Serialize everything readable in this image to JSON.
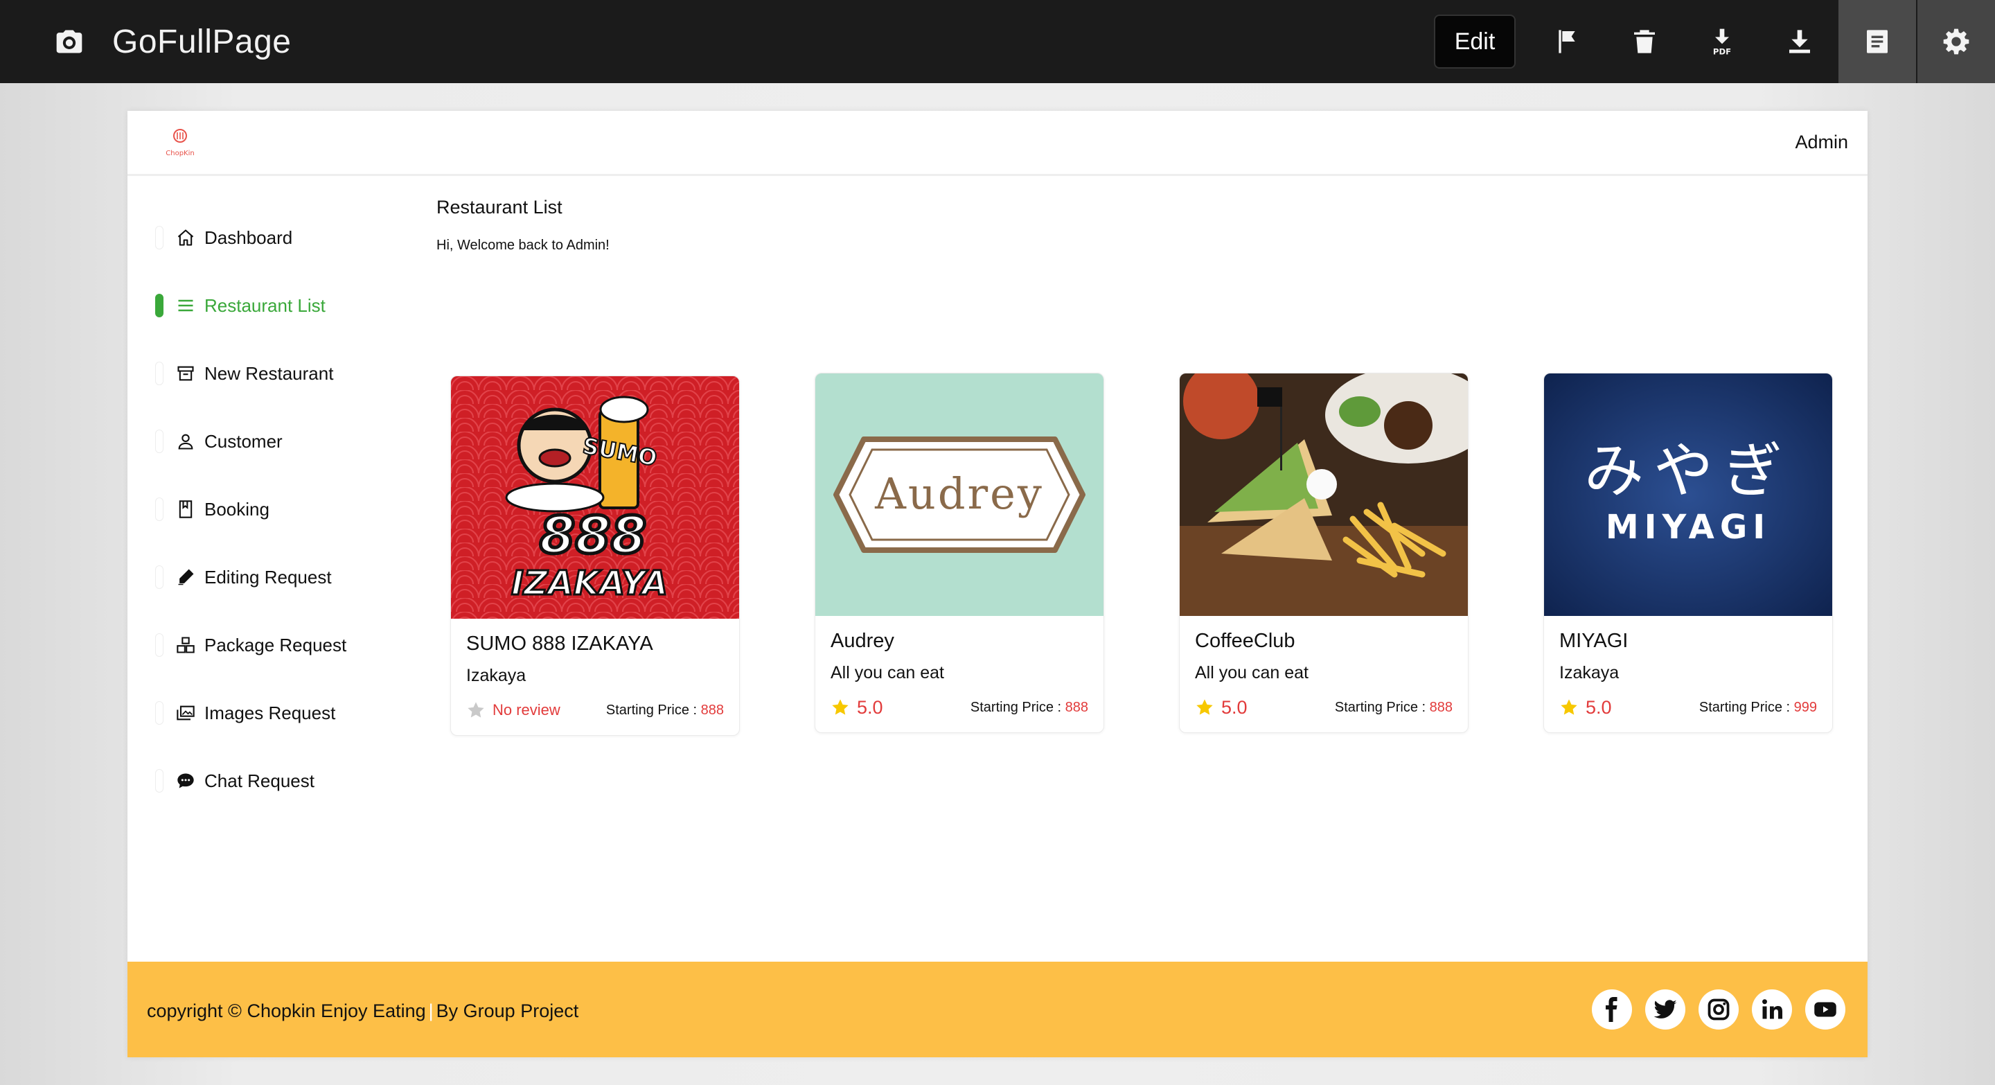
{
  "extension": {
    "title": "GoFullPage",
    "edit_label": "Edit",
    "icons": [
      "camera-icon",
      "flag-icon",
      "trash-icon",
      "download-pdf-icon",
      "download-icon",
      "notes-icon",
      "gear-icon"
    ]
  },
  "header": {
    "brand": "ChopKin",
    "user": "Admin"
  },
  "sidebar": {
    "items": [
      {
        "label": "Dashboard",
        "icon": "home-icon"
      },
      {
        "label": "Restaurant List",
        "icon": "list-icon",
        "active": true
      },
      {
        "label": "New Restaurant",
        "icon": "archive-icon"
      },
      {
        "label": "Customer",
        "icon": "user-icon"
      },
      {
        "label": "Booking",
        "icon": "book-icon"
      },
      {
        "label": "Editing Request",
        "icon": "pencil-icon"
      },
      {
        "label": "Package Request",
        "icon": "boxes-icon"
      },
      {
        "label": "Images Request",
        "icon": "images-icon"
      },
      {
        "label": "Chat Request",
        "icon": "chat-icon"
      }
    ]
  },
  "main": {
    "title": "Restaurant List",
    "welcome": "Hi, Welcome back to Admin!",
    "price_label": "Starting Price :",
    "restaurants": [
      {
        "name": "SUMO 888 IZAKAYA",
        "category": "Izakaya",
        "rating": "No review",
        "price": "888",
        "image_text": [
          "SUMO",
          "888",
          "IZAKAYA"
        ]
      },
      {
        "name": "Audrey",
        "category": "All you can eat",
        "rating": "5.0",
        "price": "888",
        "image_text": [
          "Audrey"
        ]
      },
      {
        "name": "CoffeeClub",
        "category": "All you can eat",
        "rating": "5.0",
        "price": "888",
        "image_text": []
      },
      {
        "name": "MIYAGI",
        "category": "Izakaya",
        "rating": "5.0",
        "price": "999",
        "image_text": [
          "みやぎ",
          "MIYAGI"
        ]
      }
    ]
  },
  "footer": {
    "copyright": "copyright © Chopkin Enjoy Eating",
    "separator": "|",
    "credit": "By Group Project",
    "socials": [
      "facebook-icon",
      "twitter-icon",
      "instagram-icon",
      "linkedin-icon",
      "youtube-icon"
    ]
  },
  "colors": {
    "accent_green": "#3aa83a",
    "price_red": "#e23b3b",
    "footer_yellow": "#fdbf47",
    "topbar": "#1b1b1b"
  }
}
